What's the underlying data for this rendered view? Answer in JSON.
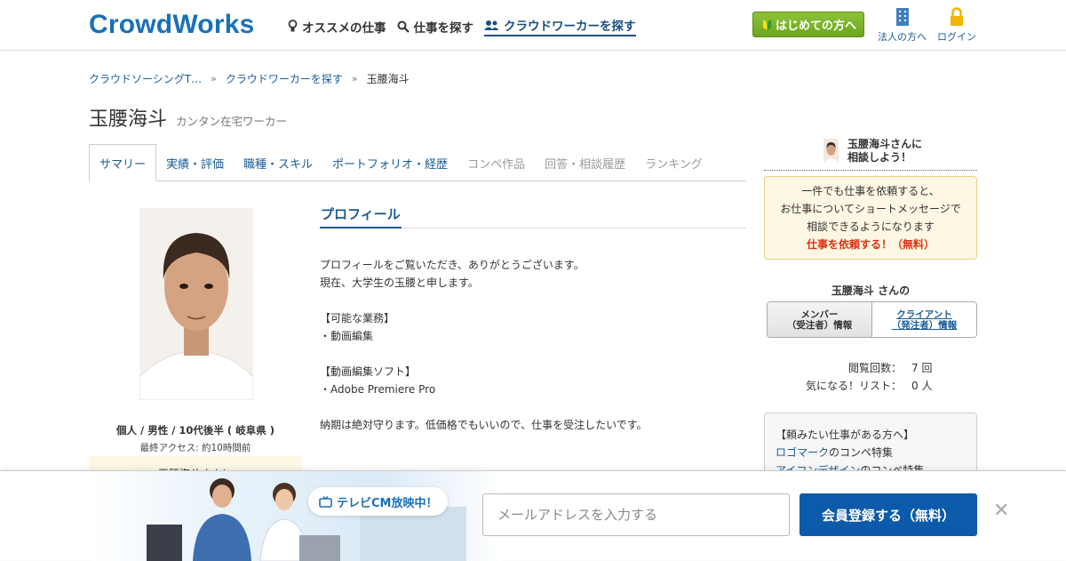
{
  "header": {
    "logo": "CrowdWorks",
    "nav": [
      {
        "label": "オススメの仕事",
        "icon": "lightbulb-icon"
      },
      {
        "label": "仕事を探す",
        "icon": "search-icon"
      },
      {
        "label": "クラウドワーカーを探す",
        "icon": "people-icon"
      }
    ],
    "beginner_button": "はじめての方へ",
    "corporate_link": "法人の方へ",
    "login_link": "ログイン"
  },
  "breadcrumb": {
    "items": [
      "クラウドソーシングT…",
      "クラウドワーカーを探す"
    ],
    "current": "玉腰海斗",
    "separator": "»"
  },
  "profile": {
    "name": "玉腰海斗",
    "subtitle": "カンタン在宅ワーカー",
    "info": "個人 / 男性 / 10代後半 ( 岐阜県 )",
    "last_access": "最終アクセス: 約10時間前",
    "consult_strip": "玉腰海斗さんに"
  },
  "tabs": [
    {
      "label": "サマリー",
      "state": "active"
    },
    {
      "label": "実績・評価",
      "state": "link"
    },
    {
      "label": "職種・スキル",
      "state": "link"
    },
    {
      "label": "ポートフォリオ・経歴",
      "state": "link"
    },
    {
      "label": "コンペ作品",
      "state": "disabled"
    },
    {
      "label": "回答・相談履歴",
      "state": "disabled"
    },
    {
      "label": "ランキング",
      "state": "disabled"
    }
  ],
  "profile_section": {
    "heading": "プロフィール",
    "lines": [
      "プロフィールをご覧いただき、ありがとうございます。",
      "現在、大学生の玉腰と申します。",
      "",
      "【可能な業務】",
      "・動画編集",
      "",
      "【動画編集ソフト】",
      "・Adobe Premiere Pro",
      "",
      "納期は絶対守ります。低価格でもいいので、仕事を受注したいです。"
    ]
  },
  "sidebar": {
    "consult_title_line1": "玉腰海斗さんに",
    "consult_title_line2": "相談しよう！",
    "notice_line1": "一件でも仕事を依頼すると、",
    "notice_line2": "お仕事についてショートメッセージで",
    "notice_line3": "相談できるようになります",
    "notice_cta": "仕事を依頼する！（無料）",
    "member_title": "玉腰海斗 さんの",
    "toggle_member_line1": "メンバー",
    "toggle_member_line2": "（受注者）情報",
    "toggle_client_line1": "クライアント",
    "toggle_client_line2": "（発注者）情報",
    "stats": [
      {
        "label": "閲覧回数：",
        "value": "7 回"
      },
      {
        "label": "気になる！リスト：",
        "value": "0 人"
      }
    ],
    "box_title": "【頼みたい仕事がある方へ】",
    "box_links": [
      {
        "link": "ロゴマーク",
        "suffix": "のコンペ特集"
      },
      {
        "link": "アイコンデザイン",
        "suffix": "のコンペ特集"
      }
    ]
  },
  "banner": {
    "tv_text": "テレビCM放映中！",
    "email_placeholder": "メールアドレスを入力する",
    "register_button": "会員登録する（無料）",
    "close": "✕"
  },
  "colors": {
    "brand": "#1a70b8",
    "link": "#1a5c96",
    "green_button": "#6aa61c",
    "register_button": "#0c5aaa",
    "cta_red": "#e03010",
    "notice_bg": "#fdf7e4"
  }
}
